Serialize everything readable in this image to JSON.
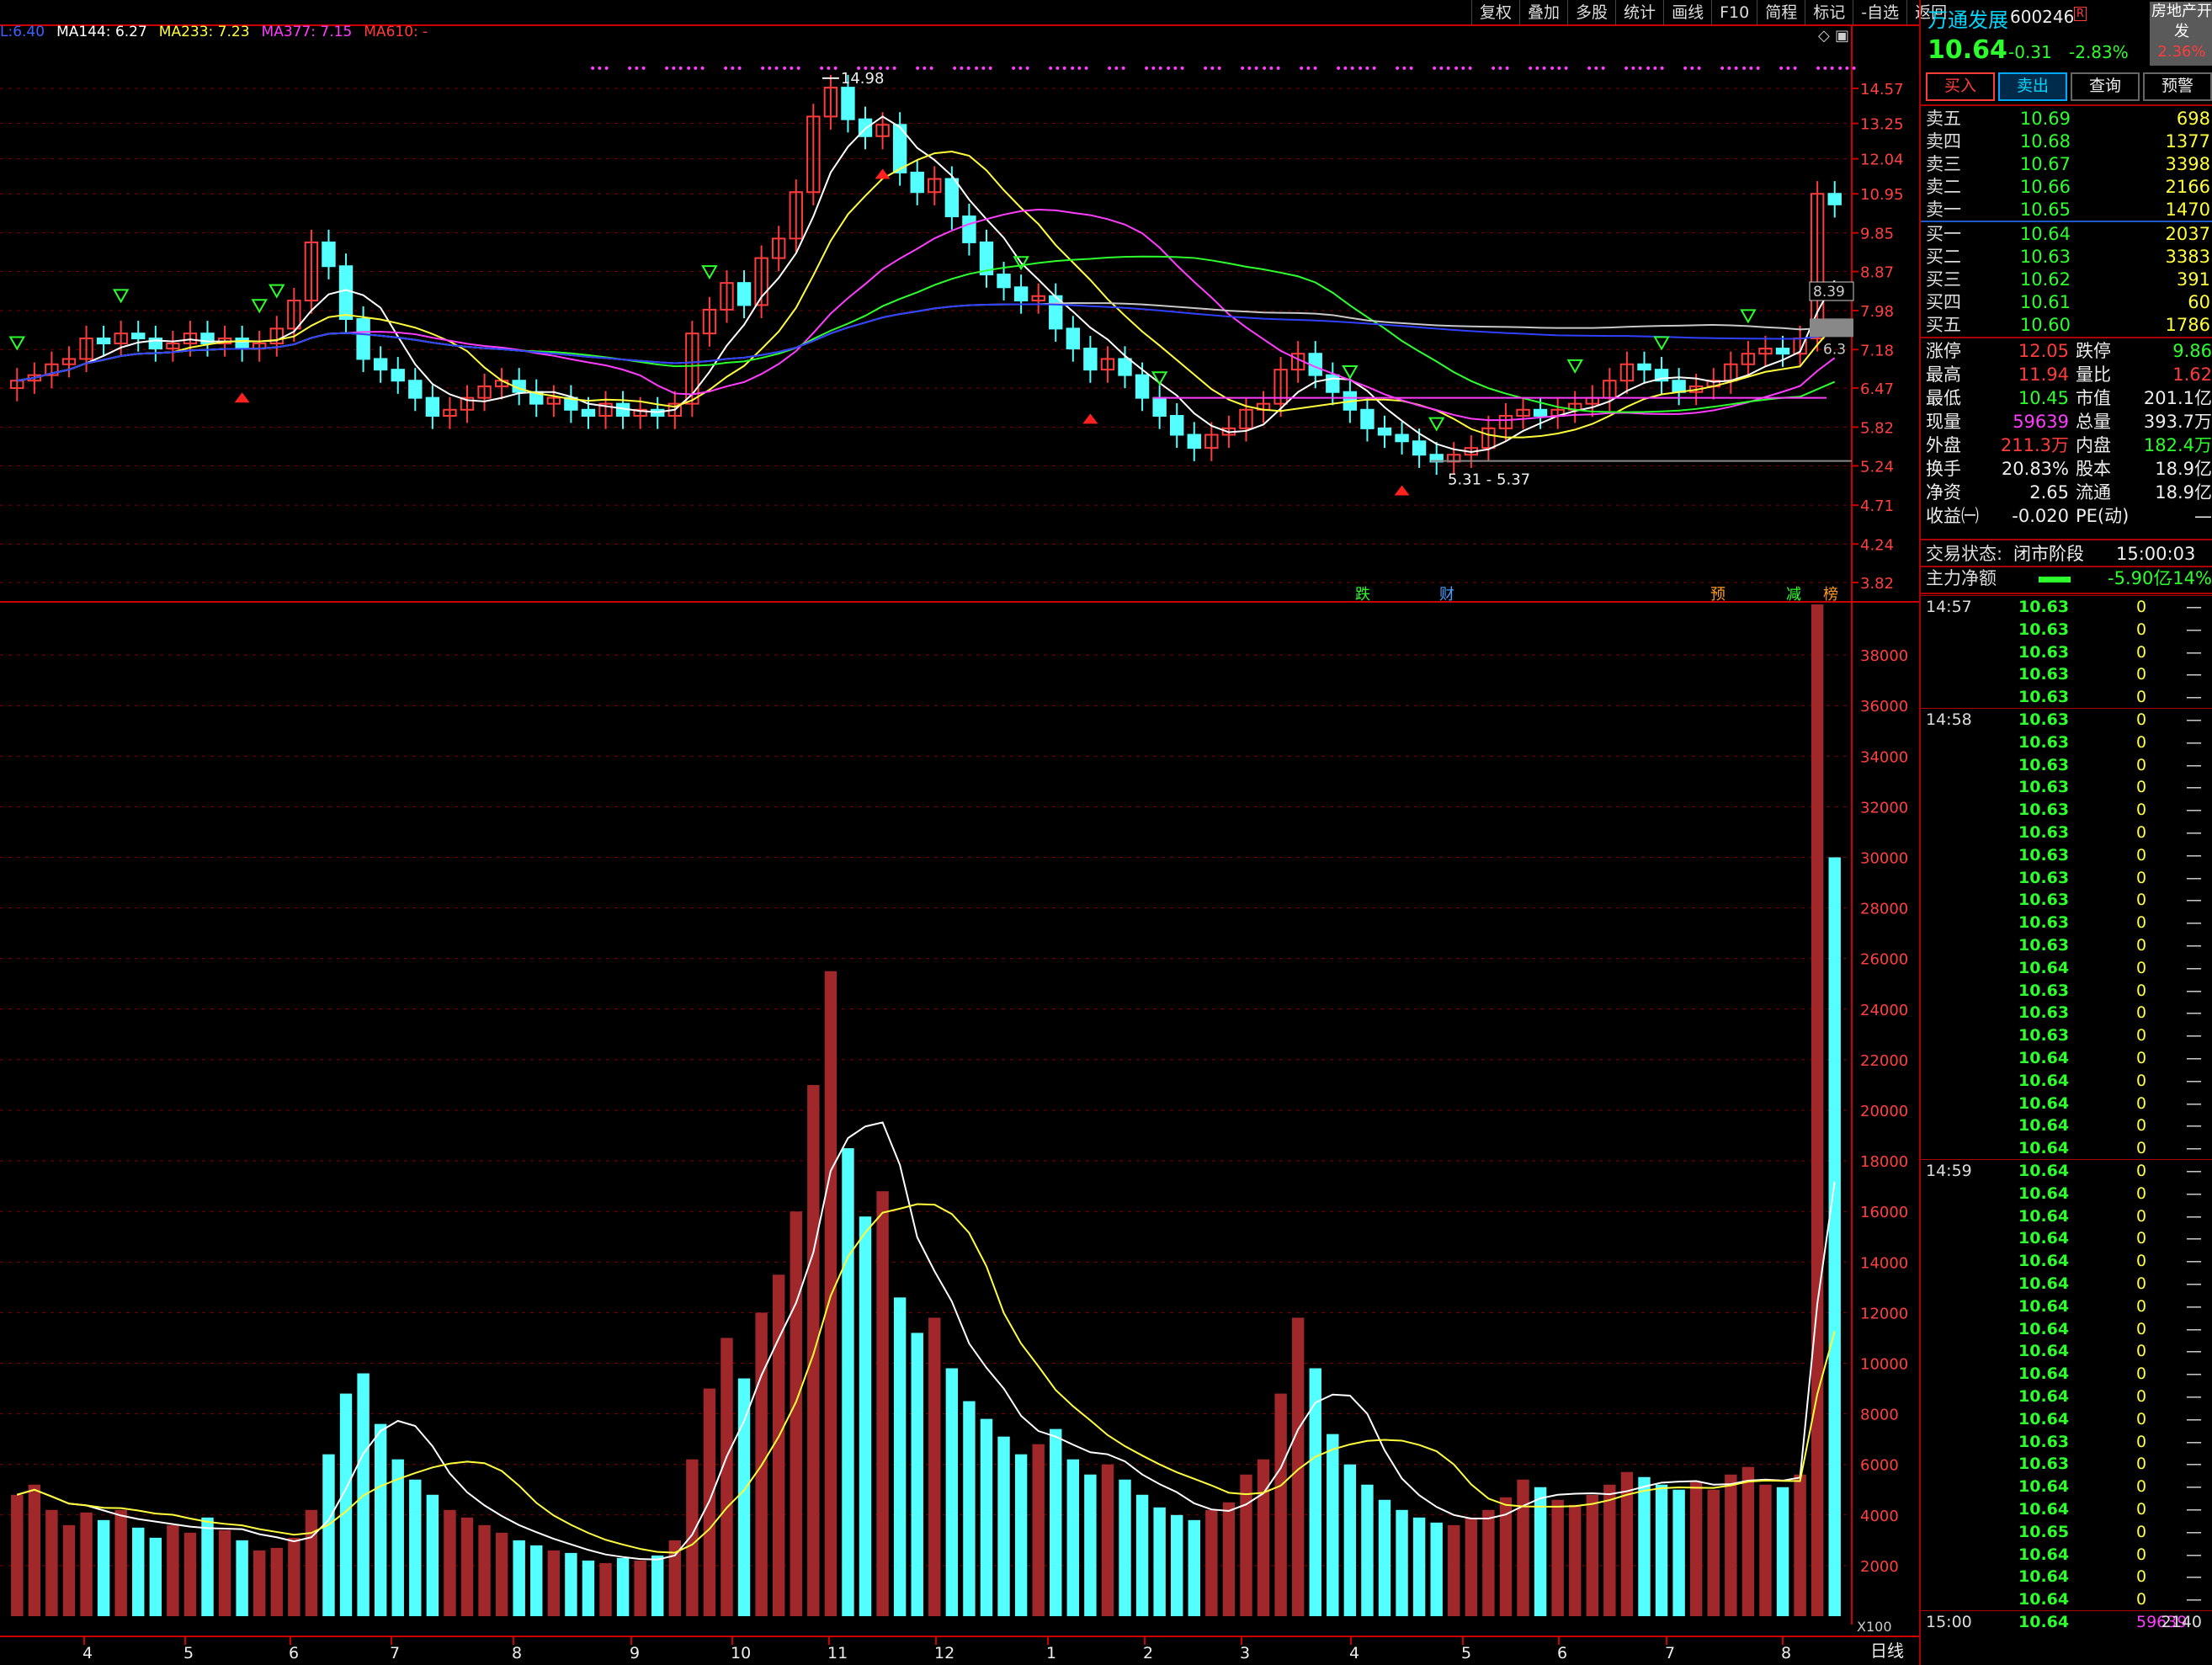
{
  "toolbar": [
    "复权",
    "叠加",
    "多股",
    "统计",
    "画线",
    "F10",
    "简程",
    "标记",
    "-自选",
    "返回"
  ],
  "ma_legend": [
    {
      "label": "L:6.40",
      "color": "#4060ff"
    },
    {
      "label": "MA144: 6.27",
      "color": "#ffffff"
    },
    {
      "label": "MA233: 7.23",
      "color": "#ffff3c"
    },
    {
      "label": "MA377: 7.15",
      "color": "#ff3cff"
    },
    {
      "label": "MA610: -",
      "color": "#ff3c3c"
    }
  ],
  "price_axis": [
    "14.57",
    "13.25",
    "12.04",
    "10.95",
    "9.85",
    "8.87",
    "7.98",
    "7.18",
    "6.47",
    "5.82",
    "5.24",
    "4.71",
    "4.24",
    "3.82"
  ],
  "price_marks": {
    "high_label": "14.98",
    "low_label": "5.31 - 5.37",
    "right_label1": "8.39",
    "right_label2": "6.3"
  },
  "event_badges": [
    {
      "text": "跌",
      "color": "#2cff2c"
    },
    {
      "text": "财",
      "color": "#4aa0ff"
    },
    {
      "text": "预",
      "color": "#ff9a1e"
    },
    {
      "text": "减",
      "color": "#2cff2c"
    },
    {
      "text": "榜",
      "color": "#ff9a1e"
    }
  ],
  "volume_axis": [
    "38000",
    "36000",
    "34000",
    "32000",
    "30000",
    "28000",
    "26000",
    "24000",
    "22000",
    "20000",
    "18000",
    "16000",
    "14000",
    "12000",
    "10000",
    "8000",
    "6000",
    "4000",
    "2000"
  ],
  "volume_unit": "X100",
  "month_labels": [
    "4",
    "5",
    "6",
    "7",
    "8",
    "9",
    "10",
    "11",
    "12",
    "1",
    "2",
    "3",
    "4",
    "5",
    "6",
    "7",
    "8"
  ],
  "period": "日线",
  "stock": {
    "name": "万通发展",
    "code": "600246",
    "tag": "R",
    "price": "10.64",
    "change": "-0.31",
    "pct": "-2.83%",
    "sector": "房地产开发",
    "sector_pct": "2.36%"
  },
  "actions": [
    "买入",
    "卖出",
    "查询",
    "预警"
  ],
  "asks": [
    {
      "label": "卖五",
      "price": "10.69",
      "vol": "698"
    },
    {
      "label": "卖四",
      "price": "10.68",
      "vol": "1377"
    },
    {
      "label": "卖三",
      "price": "10.67",
      "vol": "3398"
    },
    {
      "label": "卖二",
      "price": "10.66",
      "vol": "2166"
    },
    {
      "label": "卖一",
      "price": "10.65",
      "vol": "1470"
    }
  ],
  "bids": [
    {
      "label": "买一",
      "price": "10.64",
      "vol": "2037"
    },
    {
      "label": "买二",
      "price": "10.63",
      "vol": "3383"
    },
    {
      "label": "买三",
      "price": "10.62",
      "vol": "391"
    },
    {
      "label": "买四",
      "price": "10.61",
      "vol": "60"
    },
    {
      "label": "买五",
      "price": "10.60",
      "vol": "1786"
    }
  ],
  "stats": [
    {
      "l1": "涨停",
      "v1": "12.05",
      "c1": "red",
      "l2": "跌停",
      "v2": "9.86",
      "c2": "green"
    },
    {
      "l1": "最高",
      "v1": "11.94",
      "c1": "red",
      "l2": "量比",
      "v2": "1.62",
      "c2": "red"
    },
    {
      "l1": "最低",
      "v1": "10.45",
      "c1": "green",
      "l2": "市值",
      "v2": "201.1亿",
      "c2": "wht"
    },
    {
      "l1": "现量",
      "v1": "59639",
      "c1": "mag",
      "l2": "总量",
      "v2": "393.7万",
      "c2": "wht"
    },
    {
      "l1": "外盘",
      "v1": "211.3万",
      "c1": "red",
      "l2": "内盘",
      "v2": "182.4万",
      "c2": "green"
    },
    {
      "l1": "换手",
      "v1": "20.83%",
      "c1": "wht",
      "l2": "股本",
      "v2": "18.9亿",
      "c2": "wht"
    },
    {
      "l1": "净资",
      "v1": "2.65",
      "c1": "wht",
      "l2": "流通",
      "v2": "18.9亿",
      "c2": "wht"
    },
    {
      "l1": "收益㈠",
      "v1": "-0.020",
      "c1": "wht",
      "l2": "PE(动)",
      "v2": "—",
      "c2": "wht"
    }
  ],
  "trade_status": {
    "label": "交易状态:",
    "value": "闭市阶段",
    "time": "15:00:03"
  },
  "main_flow": {
    "label": "主力净额",
    "value": "-5.90亿",
    "pct": "-14%"
  },
  "ticks": [
    {
      "t": "14:57",
      "p": "10.63",
      "v": "0",
      "d": "—"
    },
    {
      "t": "",
      "p": "10.63",
      "v": "0",
      "d": "—"
    },
    {
      "t": "",
      "p": "10.63",
      "v": "0",
      "d": "—"
    },
    {
      "t": "",
      "p": "10.63",
      "v": "0",
      "d": "—"
    },
    {
      "t": "",
      "p": "10.63",
      "v": "0",
      "d": "—"
    },
    {
      "t": "14:58",
      "p": "10.63",
      "v": "0",
      "d": "—"
    },
    {
      "t": "",
      "p": "10.63",
      "v": "0",
      "d": "—"
    },
    {
      "t": "",
      "p": "10.63",
      "v": "0",
      "d": "—"
    },
    {
      "t": "",
      "p": "10.63",
      "v": "0",
      "d": "—"
    },
    {
      "t": "",
      "p": "10.63",
      "v": "0",
      "d": "—"
    },
    {
      "t": "",
      "p": "10.63",
      "v": "0",
      "d": "—"
    },
    {
      "t": "",
      "p": "10.63",
      "v": "0",
      "d": "—"
    },
    {
      "t": "",
      "p": "10.63",
      "v": "0",
      "d": "—"
    },
    {
      "t": "",
      "p": "10.63",
      "v": "0",
      "d": "—"
    },
    {
      "t": "",
      "p": "10.63",
      "v": "0",
      "d": "—"
    },
    {
      "t": "",
      "p": "10.63",
      "v": "0",
      "d": "—"
    },
    {
      "t": "",
      "p": "10.64",
      "v": "0",
      "d": "—"
    },
    {
      "t": "",
      "p": "10.63",
      "v": "0",
      "d": "—"
    },
    {
      "t": "",
      "p": "10.63",
      "v": "0",
      "d": "—"
    },
    {
      "t": "",
      "p": "10.63",
      "v": "0",
      "d": "—"
    },
    {
      "t": "",
      "p": "10.64",
      "v": "0",
      "d": "—"
    },
    {
      "t": "",
      "p": "10.64",
      "v": "0",
      "d": "—"
    },
    {
      "t": "",
      "p": "10.64",
      "v": "0",
      "d": "—"
    },
    {
      "t": "",
      "p": "10.64",
      "v": "0",
      "d": "—"
    },
    {
      "t": "",
      "p": "10.64",
      "v": "0",
      "d": "—"
    },
    {
      "t": "14:59",
      "p": "10.64",
      "v": "0",
      "d": "—"
    },
    {
      "t": "",
      "p": "10.64",
      "v": "0",
      "d": "—"
    },
    {
      "t": "",
      "p": "10.64",
      "v": "0",
      "d": "—"
    },
    {
      "t": "",
      "p": "10.64",
      "v": "0",
      "d": "—"
    },
    {
      "t": "",
      "p": "10.64",
      "v": "0",
      "d": "—"
    },
    {
      "t": "",
      "p": "10.64",
      "v": "0",
      "d": "—"
    },
    {
      "t": "",
      "p": "10.64",
      "v": "0",
      "d": "—"
    },
    {
      "t": "",
      "p": "10.64",
      "v": "0",
      "d": "—"
    },
    {
      "t": "",
      "p": "10.64",
      "v": "0",
      "d": "—"
    },
    {
      "t": "",
      "p": "10.64",
      "v": "0",
      "d": "—"
    },
    {
      "t": "",
      "p": "10.64",
      "v": "0",
      "d": "—"
    },
    {
      "t": "",
      "p": "10.64",
      "v": "0",
      "d": "—"
    },
    {
      "t": "",
      "p": "10.63",
      "v": "0",
      "d": "—"
    },
    {
      "t": "",
      "p": "10.63",
      "v": "0",
      "d": "—"
    },
    {
      "t": "",
      "p": "10.64",
      "v": "0",
      "d": "—"
    },
    {
      "t": "",
      "p": "10.64",
      "v": "0",
      "d": "—"
    },
    {
      "t": "",
      "p": "10.65",
      "v": "0",
      "d": "—"
    },
    {
      "t": "",
      "p": "10.64",
      "v": "0",
      "d": "—"
    },
    {
      "t": "",
      "p": "10.64",
      "v": "0",
      "d": "—"
    },
    {
      "t": "",
      "p": "10.64",
      "v": "0",
      "d": "—"
    },
    {
      "t": "15:00",
      "p": "10.64",
      "v": "59639",
      "d": "2140"
    }
  ],
  "colors": {
    "up": "#ff3c3c",
    "down": "#54ffff",
    "up_vol": "#a0282a",
    "grid": "#7a0000",
    "axis_text": "#ff4040"
  },
  "chart_data": [
    {
      "type": "candlestick",
      "title": "",
      "ylim": [
        3.82,
        14.98
      ],
      "y_ticks": [
        14.57,
        13.25,
        12.04,
        10.95,
        9.85,
        8.87,
        7.98,
        7.18,
        6.47,
        5.82,
        5.24,
        4.71,
        4.24,
        3.82
      ],
      "x_months": [
        "4",
        "5",
        "6",
        "7",
        "8",
        "9",
        "10",
        "11",
        "12",
        "1",
        "2",
        "3",
        "4",
        "5",
        "6",
        "7",
        "8"
      ],
      "close_series": [
        6.6,
        6.7,
        6.9,
        7.0,
        7.4,
        7.3,
        7.5,
        7.4,
        7.2,
        7.3,
        7.5,
        7.3,
        7.4,
        7.2,
        7.3,
        7.6,
        8.2,
        9.6,
        9.0,
        7.8,
        7.0,
        6.8,
        6.6,
        6.3,
        6.0,
        6.1,
        6.3,
        6.5,
        6.6,
        6.4,
        6.2,
        6.3,
        6.1,
        6.0,
        6.2,
        6.0,
        6.1,
        6.0,
        6.2,
        7.5,
        8.0,
        8.6,
        8.1,
        9.2,
        9.7,
        11.0,
        13.5,
        14.6,
        13.4,
        12.8,
        13.2,
        11.6,
        11.0,
        11.4,
        10.3,
        9.6,
        8.8,
        8.5,
        8.2,
        8.3,
        7.6,
        7.2,
        6.8,
        7.0,
        6.7,
        6.3,
        6.0,
        5.7,
        5.5,
        5.7,
        5.8,
        6.1,
        6.2,
        6.8,
        7.1,
        6.7,
        6.4,
        6.1,
        5.8,
        5.7,
        5.6,
        5.4,
        5.3,
        5.4,
        5.5,
        5.8,
        6.0,
        6.1,
        6.0,
        6.1,
        6.2,
        6.3,
        6.6,
        6.9,
        6.8,
        6.6,
        6.4,
        6.5,
        6.6,
        6.9,
        7.1,
        7.2,
        7.1,
        7.4,
        10.95,
        10.64
      ],
      "ma_names": [
        "MA144",
        "MA233",
        "MA377",
        "MA610"
      ],
      "ma_values": [
        6.27,
        7.23,
        7.15,
        null
      ],
      "high": 14.98,
      "low_range": "5.31 - 5.37"
    },
    {
      "type": "bar",
      "title": "",
      "ylabel": "X100",
      "ylim": [
        0,
        40000
      ],
      "y_ticks": [
        2000,
        4000,
        6000,
        8000,
        10000,
        12000,
        14000,
        16000,
        18000,
        20000,
        22000,
        24000,
        26000,
        28000,
        30000,
        32000,
        34000,
        36000,
        38000
      ],
      "values": [
        4800,
        5200,
        4200,
        3600,
        4100,
        3800,
        4200,
        3500,
        3100,
        3600,
        3300,
        3900,
        3400,
        3000,
        2600,
        2700,
        3100,
        4200,
        6400,
        8800,
        9600,
        7600,
        6200,
        5400,
        4800,
        4200,
        3900,
        3600,
        3300,
        3000,
        2800,
        2600,
        2500,
        2200,
        2100,
        2300,
        2200,
        2400,
        3000,
        6200,
        9000,
        11000,
        9400,
        12000,
        13500,
        16000,
        21000,
        25500,
        18500,
        15800,
        16800,
        12600,
        11200,
        11800,
        9800,
        8500,
        7800,
        7100,
        6400,
        6800,
        7400,
        6200,
        5600,
        6000,
        5400,
        4800,
        4300,
        4000,
        3800,
        4200,
        4500,
        5600,
        6200,
        8800,
        11800,
        9800,
        7200,
        6000,
        5200,
        4600,
        4200,
        3900,
        3700,
        3600,
        3900,
        4200,
        4700,
        5400,
        5100,
        4600,
        4400,
        4800,
        5200,
        5700,
        5500,
        5200,
        5000,
        5300,
        5000,
        5600,
        5900,
        5200,
        5100,
        5600,
        40000,
        30000
      ],
      "legend": []
    }
  ]
}
